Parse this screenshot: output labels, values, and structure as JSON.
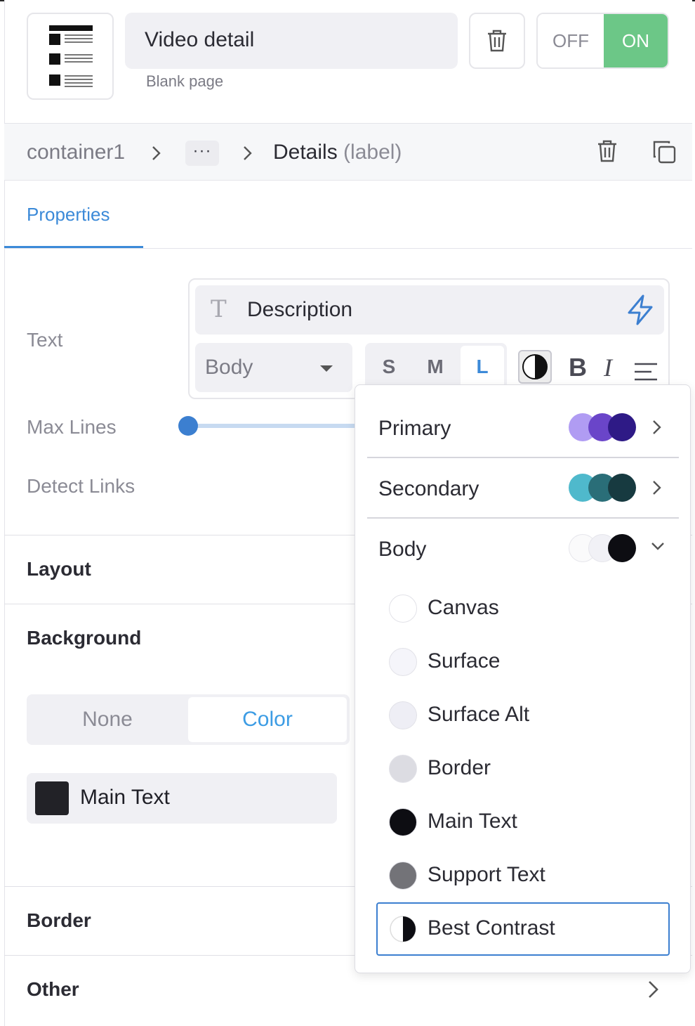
{
  "header": {
    "title": "Video detail",
    "subtitle": "Blank page",
    "toggle": {
      "off_label": "OFF",
      "on_label": "ON",
      "state": "on",
      "on_color": "#6cc787"
    }
  },
  "breadcrumb": {
    "root": "container1",
    "more": "···",
    "current": "Details",
    "current_type": "(label)"
  },
  "tabs": [
    {
      "label": "Properties",
      "active": true
    }
  ],
  "properties": {
    "text": {
      "label": "Text",
      "value": "Description",
      "style": "Body",
      "sizes": [
        "S",
        "M",
        "L"
      ],
      "selected_size": "L",
      "format_buttons": {
        "bold": "B",
        "italic": "I"
      }
    },
    "max_lines": {
      "label": "Max Lines"
    },
    "detect_links": {
      "label": "Detect Links"
    }
  },
  "sections": {
    "layout": "Layout",
    "background": "Background",
    "border": "Border",
    "other": "Other"
  },
  "background": {
    "options": [
      "None",
      "Color"
    ],
    "selected": "Color",
    "color_name": "Main Text"
  },
  "color_popover": {
    "groups": [
      {
        "label": "Primary",
        "expanded": false,
        "swatches": [
          "#b09cf3",
          "#6a45c9",
          "#2e1a86"
        ]
      },
      {
        "label": "Secondary",
        "expanded": false,
        "swatches": [
          "#4fb9cc",
          "#2a6e78",
          "#173a40"
        ]
      },
      {
        "label": "Body",
        "expanded": true,
        "swatches": [
          "#fafafb",
          "#f1f1f6",
          "#0d0d12"
        ]
      }
    ],
    "body_colors": [
      {
        "name": "Canvas",
        "color": "#ffffff"
      },
      {
        "name": "Surface",
        "color": "#f5f5fa"
      },
      {
        "name": "Surface Alt",
        "color": "#eeeef5"
      },
      {
        "name": "Border",
        "color": "#dcdce2"
      },
      {
        "name": "Main Text",
        "color": "#0d0d12"
      },
      {
        "name": "Support Text",
        "color": "#737378"
      },
      {
        "name": "Best Contrast",
        "color": "contrast",
        "selected": true
      }
    ],
    "accent": "#3c7fd0"
  }
}
